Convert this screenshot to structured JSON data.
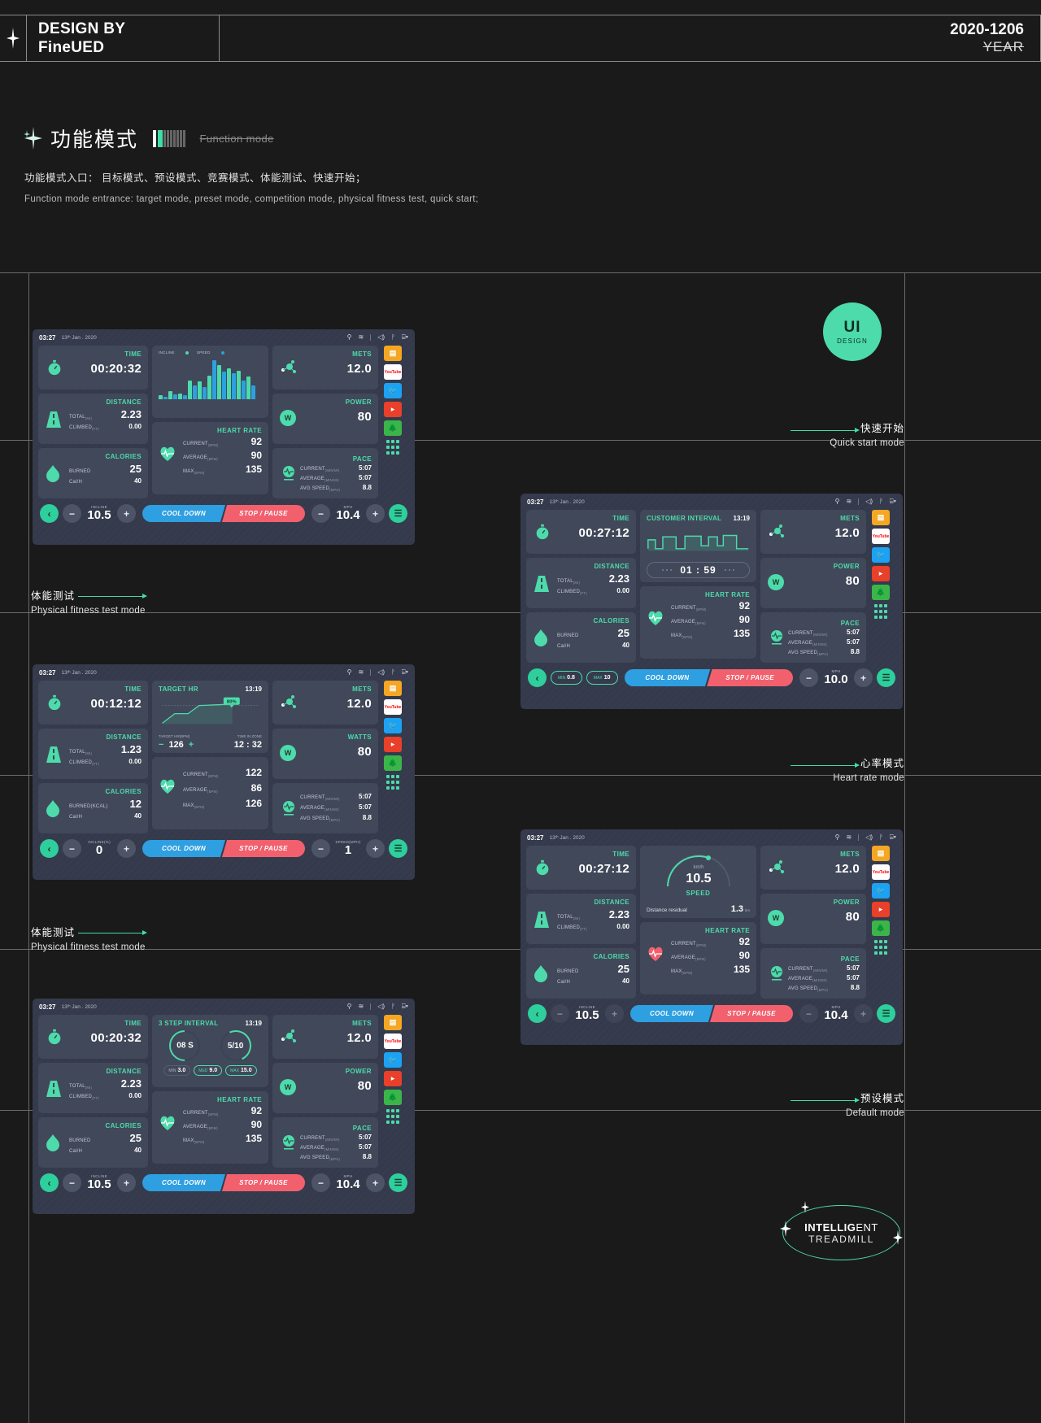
{
  "header": {
    "design_by": "DESIGN BY",
    "studio": "FineUED",
    "date": "2020-1206",
    "year": "YEAR"
  },
  "section": {
    "title_cn": "功能模式",
    "title_en": "Function mode",
    "desc_cn": "功能模式入口： 目标模式、预设模式、竞赛模式、体能测试、快速开始；",
    "desc_en": "Function mode entrance: target mode, preset mode, competition mode, physical fitness test, quick start;"
  },
  "ui_badge": {
    "line1": "UI",
    "line2": "DESIGN"
  },
  "mode_labels": {
    "quick_start": {
      "cn": "快速开始",
      "en": "Quick start mode"
    },
    "fitness_test_1": {
      "cn": "体能测试",
      "en": "Physical fitness test mode"
    },
    "fitness_test_2": {
      "cn": "体能测试",
      "en": "Physical fitness test mode"
    },
    "heart_rate": {
      "cn": "心率模式",
      "en": "Heart rate mode"
    },
    "default": {
      "cn": "预设模式",
      "en": "Default mode"
    }
  },
  "footer_badge": {
    "bold": "INTELLIG",
    "rest": "ENT",
    "line2": "TREADMILL"
  },
  "common": {
    "status_time": "03:27",
    "status_date": "13ᵗʰ Jan . 2020",
    "status_icons": [
      "usb-icon",
      "wifi-icon",
      "volume-icon",
      "bluetooth-icon",
      "cast-icon"
    ],
    "labels": {
      "time": "TIME",
      "distance": "DISTANCE",
      "calories": "CALORIES",
      "mets": "METS",
      "power": "POWER",
      "watts": "WATTS",
      "pace": "PACE",
      "heart_rate": "HEART RATE"
    },
    "keys": {
      "total": "TOTAL",
      "total_u": "(MI)",
      "climbed": "CLIMBED",
      "climbed_u": "(FT)",
      "burned": "BURNED",
      "burned_kcal": "BURNED(KCAL)",
      "calh": "Cal/H",
      "current": "CURRENT",
      "bpm": "(BPM)",
      "average": "AVERAGE",
      "max": "MAX",
      "pace_cur": "CURRENT",
      "pace_u": "(MIN/MI)",
      "pace_avg": "AVERAGE",
      "avg_speed": "AVG SPEED",
      "avg_speed_u": "(MPH)"
    },
    "buttons": {
      "cool_down": "COOL DOWN",
      "stop_pause": "STOP / PAUSE",
      "back": "‹",
      "minus": "−",
      "plus": "+",
      "menu": "☰"
    },
    "app_icons": [
      "monitor-icon",
      "youtube-icon",
      "twitter-icon",
      "netflix-icon",
      "forest-icon",
      "apps-grid-icon"
    ],
    "youtube_label": "YouTube",
    "watt_letter": "W"
  },
  "screens": {
    "quick_start": {
      "time": "00:20:32",
      "distance": {
        "total": "2.23",
        "climbed": "0.00"
      },
      "calories": {
        "burned": "25",
        "calh": "40"
      },
      "mets": "12.0",
      "power": "80",
      "heart_rate": {
        "current": "92",
        "average": "90",
        "max": "135"
      },
      "pace": {
        "current": "5:07",
        "average": "5:07",
        "avg_speed": "8.8"
      },
      "chart": {
        "legend": [
          "INCLINE",
          "SPEED"
        ]
      },
      "incline": {
        "label": "INCLINE",
        "value": "10.5"
      },
      "speed": {
        "label": "MPH",
        "value": "10.4"
      }
    },
    "heart_rate": {
      "time": "00:27:12",
      "distance": {
        "total": "2.23",
        "climbed": "0.00"
      },
      "calories": {
        "burned": "25",
        "calh": "40"
      },
      "mets": "12.0",
      "power": "80",
      "heart_rate": {
        "current": "92",
        "average": "90",
        "max": "135"
      },
      "pace": {
        "current": "5:07",
        "average": "5:07",
        "avg_speed": "8.8"
      },
      "interval": {
        "title": "CUSTOMER INTERVAL",
        "time": "13:19",
        "countdown": "01 : 59"
      },
      "minmax": {
        "min_label": "MIN",
        "min": "0.8",
        "max_label": "MAX",
        "max": "10"
      },
      "speed": {
        "label": "MPH",
        "value": "10.0"
      }
    },
    "fitness_1": {
      "time": "00:12:12",
      "distance": {
        "total": "1.23",
        "climbed": "0.00"
      },
      "calories": {
        "burned": "12",
        "calh": "40"
      },
      "mets": "12.0",
      "watts": "80",
      "heart_rate": {
        "current": "122",
        "average": "86",
        "max": "126"
      },
      "pace": {
        "current": "5:07",
        "average": "5:07",
        "avg_speed": "8.8"
      },
      "target_hr": {
        "title": "TARGET HR",
        "time": "13:19",
        "badge": "80%",
        "k1": "TARGET HR(BPM)",
        "v1": "126",
        "k2": "TIME IN ZONE",
        "v2": "12 : 32"
      },
      "incline": {
        "label": "INCLINE(%)",
        "value": "0"
      },
      "speed": {
        "label": "SPEED(MPH)",
        "value": "1"
      }
    },
    "fitness_2": {
      "time": "00:20:32",
      "distance": {
        "total": "2.23",
        "climbed": "0.00"
      },
      "calories": {
        "burned": "25",
        "calh": "40"
      },
      "mets": "12.0",
      "power": "80",
      "heart_rate": {
        "current": "92",
        "average": "90",
        "max": "135"
      },
      "pace": {
        "current": "5:07",
        "average": "5:07",
        "avg_speed": "8.8"
      },
      "step": {
        "title": "3 STEP INTERVAL",
        "time": "13:19",
        "ring1": "08 S",
        "ring2": "5/10",
        "min_label": "MIN",
        "min": "3.0",
        "med_label": "MED",
        "med": "9.0",
        "max_label": "MAX",
        "max": "15.0"
      },
      "incline": {
        "label": "INCLINE",
        "value": "10.5"
      },
      "speed": {
        "label": "MPH",
        "value": "10.4"
      }
    },
    "preset": {
      "time": "00:27:12",
      "distance": {
        "total": "2.23",
        "climbed": "0.00"
      },
      "calories": {
        "burned": "25",
        "calh": "40"
      },
      "mets": "12.0",
      "power": "80",
      "heart_rate": {
        "current": "92",
        "average": "90",
        "max": "135"
      },
      "pace": {
        "current": "5:07",
        "average": "5:07",
        "avg_speed": "8.8"
      },
      "gauge": {
        "unit": "km/h",
        "value": "10.5",
        "caption": "SPEED",
        "resid_label": "Distance residual",
        "resid_value": "1.3",
        "resid_unit": "km"
      },
      "incline": {
        "label": "INCLINE",
        "value": "10.5"
      },
      "speed": {
        "label": "MPH",
        "value": "10.4"
      }
    }
  },
  "chart_data": {
    "type": "bar",
    "title": "Incline / Speed history",
    "legend": [
      "INCLINE",
      "SPEED"
    ],
    "colors": {
      "incline": "#4ddbac",
      "speed": "#2e9fe0"
    },
    "series": [
      {
        "name": "INCLINE",
        "values": [
          6,
          13,
          9,
          30,
          28,
          38,
          55,
          50,
          46,
          36
        ]
      },
      {
        "name": "SPEED",
        "values": [
          4,
          8,
          7,
          22,
          20,
          62,
          44,
          42,
          30,
          22
        ]
      }
    ],
    "ylim": [
      0,
      65
    ],
    "grid": false
  }
}
